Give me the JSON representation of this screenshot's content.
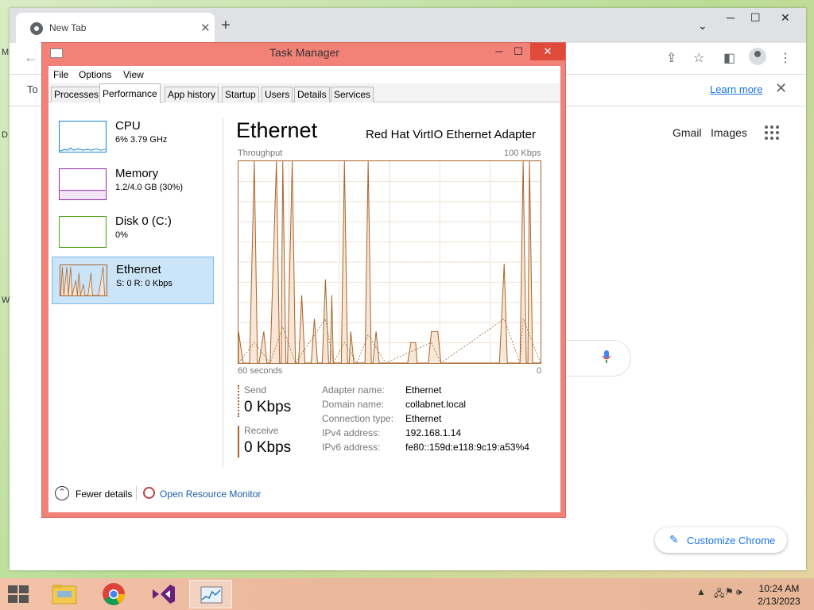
{
  "desktop": {
    "icon_letters": [
      "M",
      "D",
      "W"
    ]
  },
  "browser": {
    "tab_title": "New Tab",
    "new_tab_label": "+",
    "window_controls": {
      "menu": "⌄",
      "minimize": "─",
      "maximize": "☐",
      "close": "✕"
    },
    "toolbar": {
      "back": "←"
    },
    "infobar": {
      "text": "To",
      "learn_more": "Learn more",
      "close": "✕"
    },
    "links": {
      "gmail": "Gmail",
      "images": "Images"
    },
    "customize_label": "Customize Chrome"
  },
  "taskmanager": {
    "title": "Task Manager",
    "controls": {
      "minimize": "─",
      "maximize": "☐",
      "close": "✕"
    },
    "menu": [
      "File",
      "Options",
      "View"
    ],
    "tabs": [
      "Processes",
      "Performance",
      "App history",
      "Startup",
      "Users",
      "Details",
      "Services"
    ],
    "active_tab": "Performance",
    "sidebar": [
      {
        "name": "CPU",
        "value": "6% 3.79 GHz",
        "color": "#1786c9"
      },
      {
        "name": "Memory",
        "value": "1.2/4.0 GB (30%)",
        "color": "#8b2aa8"
      },
      {
        "name": "Disk 0 (C:)",
        "value": "0%",
        "color": "#4da016"
      },
      {
        "name": "Ethernet",
        "value": "S: 0 R: 0 Kbps",
        "color": "#a7642a"
      }
    ],
    "selected": "Ethernet",
    "detail": {
      "title": "Ethernet",
      "adapter": "Red Hat VirtIO Ethernet Adapter",
      "throughput_label": "Throughput",
      "max_label": "100 Kbps",
      "time_label": "60 seconds",
      "zero_label": "0",
      "send_label": "Send",
      "send_value": "0 Kbps",
      "receive_label": "Receive",
      "receive_value": "0 Kbps",
      "properties": [
        {
          "key": "Adapter name:",
          "value": "Ethernet"
        },
        {
          "key": "Domain name:",
          "value": "collabnet.local"
        },
        {
          "key": "Connection type:",
          "value": "Ethernet"
        },
        {
          "key": "IPv4 address:",
          "value": "192.168.1.14"
        },
        {
          "key": "IPv6 address:",
          "value": "fe80::159d:e118:9c19:a53%4"
        }
      ]
    },
    "footer": {
      "fewer_details": "Fewer details",
      "open_resource_monitor": "Open Resource Monitor"
    }
  },
  "taskbar": {
    "apps": [
      "file-explorer",
      "chrome",
      "visual-studio",
      "task-manager"
    ],
    "active_app": "task-manager",
    "tray_icons": [
      "up-arrow-icon",
      "network-icon",
      "flag-icon",
      "volume-icon"
    ],
    "time": "10:24 AM",
    "date": "2/13/2023"
  }
}
